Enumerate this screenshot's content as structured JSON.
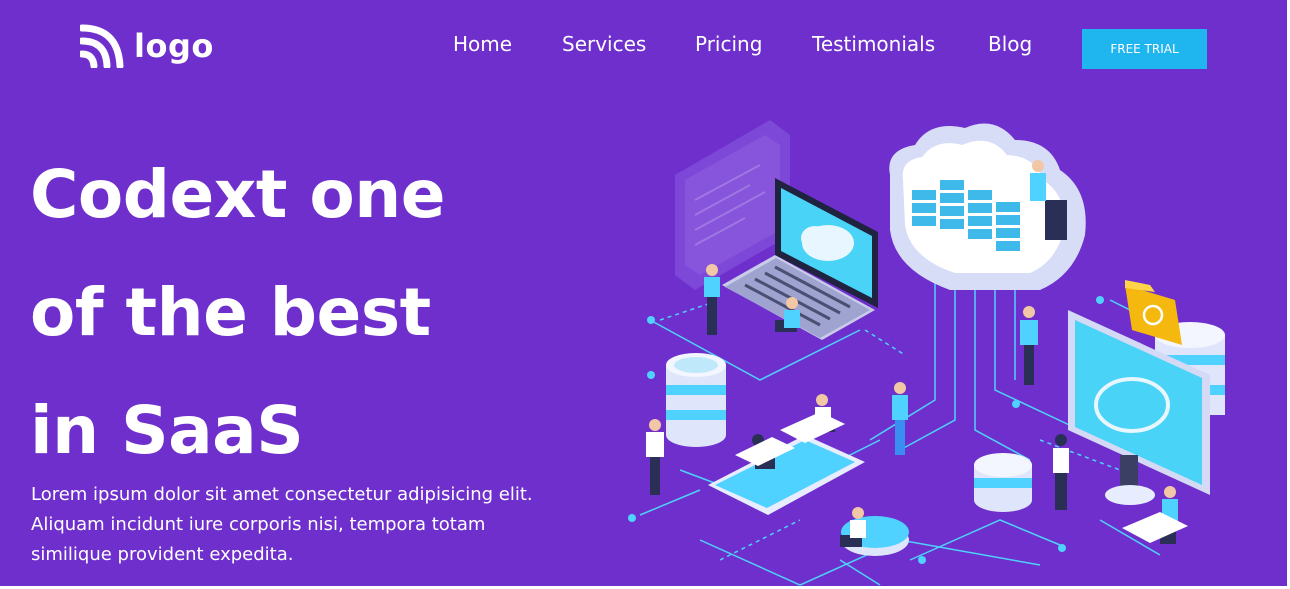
{
  "header": {
    "logo_text": "logo",
    "logo_icon": "rss-signal-icon",
    "nav": [
      "Home",
      "Services",
      "Pricing",
      "Testimonials",
      "Blog"
    ],
    "cta_label": "FREE TRIAL"
  },
  "hero": {
    "headline": [
      "Codext one",
      "of the best",
      "in SaaS"
    ],
    "description": "Lorem ipsum dolor sit amet consectetur adipisicing elit. Aliquam incidunt iure corporis nisi, tempora totam similique provident expedita."
  },
  "colors": {
    "background": "#6e2fcd",
    "cta": "#1fb5ee",
    "text": "#ffffff",
    "accent_cyan": "#4fd2ff"
  },
  "illustration": {
    "icon": "cloud-saas-isometric-illustration"
  }
}
